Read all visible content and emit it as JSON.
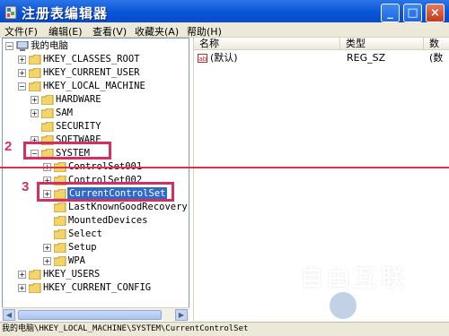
{
  "window": {
    "title": "注册表编辑器",
    "buttons": {
      "minimize": "_",
      "maximize": "□",
      "close": "×"
    }
  },
  "menu": [
    {
      "label": "文件(F)"
    },
    {
      "label": "编辑(E)"
    },
    {
      "label": "查看(V)"
    },
    {
      "label": "收藏夹(A)"
    },
    {
      "label": "帮助(H)"
    }
  ],
  "tree": [
    {
      "label": "我的电脑",
      "expander": "−",
      "icon": "computer-icon"
    },
    {
      "label": "HKEY_CLASSES_ROOT",
      "expander": "+",
      "icon": "folder-icon"
    },
    {
      "label": "HKEY_CURRENT_USER",
      "expander": "+",
      "icon": "folder-icon"
    },
    {
      "label": "HKEY_LOCAL_MACHINE",
      "expander": "−",
      "icon": "folder-icon"
    },
    {
      "label": "HARDWARE",
      "expander": "+",
      "icon": "folder-icon"
    },
    {
      "label": "SAM",
      "expander": "+",
      "icon": "folder-icon"
    },
    {
      "label": "SECURITY",
      "expander": "",
      "icon": "folder-icon"
    },
    {
      "label": "SOFTWARE",
      "expander": "+",
      "icon": "folder-icon"
    },
    {
      "label": "SYSTEM",
      "expander": "−",
      "icon": "folder-icon"
    },
    {
      "label": "ControlSet001",
      "expander": "+",
      "icon": "folder-icon"
    },
    {
      "label": "ControlSet002",
      "expander": "+",
      "icon": "folder-icon"
    },
    {
      "label": "CurrentControlSet",
      "expander": "+",
      "icon": "folder-icon",
      "selected": true
    },
    {
      "label": "LastKnownGoodRecovery",
      "expander": "",
      "icon": "folder-icon"
    },
    {
      "label": "MountedDevices",
      "expander": "",
      "icon": "folder-icon"
    },
    {
      "label": "Select",
      "expander": "",
      "icon": "folder-icon"
    },
    {
      "label": "Setup",
      "expander": "+",
      "icon": "folder-icon"
    },
    {
      "label": "WPA",
      "expander": "+",
      "icon": "folder-icon"
    },
    {
      "label": "HKEY_USERS",
      "expander": "+",
      "icon": "folder-icon"
    },
    {
      "label": "HKEY_CURRENT_CONFIG",
      "expander": "+",
      "icon": "folder-icon"
    }
  ],
  "list": {
    "columns": [
      "名称",
      "类型",
      "数"
    ],
    "rows": [
      {
        "name": "(默认)",
        "type": "REG_SZ",
        "data": "(数"
      }
    ]
  },
  "status": {
    "path": "我的电脑\\HKEY_LOCAL_MACHINE\\SYSTEM\\CurrentControlSet"
  },
  "annotations": {
    "step2": "2",
    "step3": "3",
    "color": "#d23063"
  },
  "watermark": {
    "main": "自由互联",
    "sub": "好装机"
  }
}
